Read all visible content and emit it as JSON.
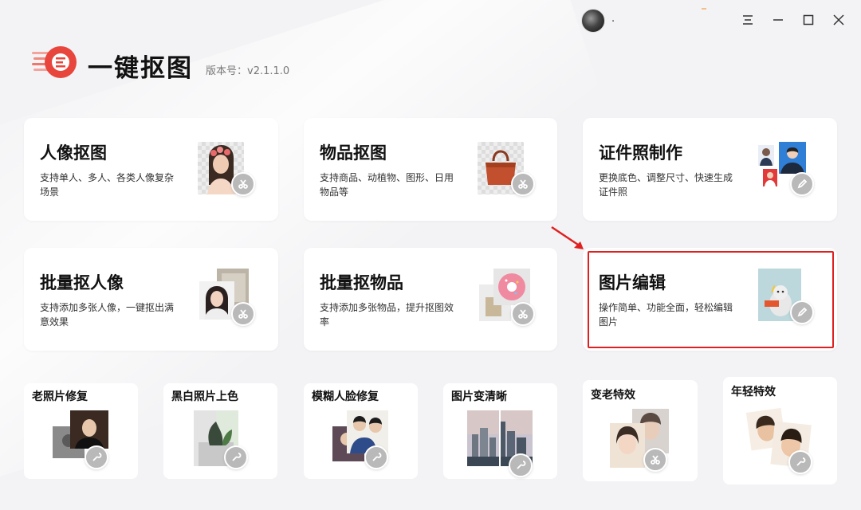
{
  "app": {
    "title": "一键抠图",
    "version": "版本号：v2.1.1.0"
  },
  "titlebar": {
    "user_name": ".",
    "icons": [
      "avatar",
      "menu-icon",
      "minimize-icon",
      "maximize-icon",
      "close-icon"
    ]
  },
  "cards": [
    {
      "title": "人像抠图",
      "desc": "支持单人、多人、各类人像复杂场景"
    },
    {
      "title": "物品抠图",
      "desc": "支持商品、动植物、图形、日用物品等"
    },
    {
      "title": "证件照制作",
      "desc": "更换底色、调整尺寸、快速生成证件照"
    },
    {
      "title": "批量抠人像",
      "desc": "支持添加多张人像，一键抠出满意效果"
    },
    {
      "title": "批量抠物品",
      "desc": "支持添加多张物品，提升抠图效率"
    },
    {
      "title": "图片编辑",
      "desc": "操作简单、功能全面，轻松编辑图片"
    }
  ],
  "small_cards": [
    {
      "title": "老照片修复"
    },
    {
      "title": "黑白照片上色"
    },
    {
      "title": "模糊人脸修复"
    },
    {
      "title": "图片变清晰"
    },
    {
      "title": "变老特效"
    },
    {
      "title": "年轻特效"
    }
  ],
  "colors": {
    "accent": "#e8453c",
    "highlight_border": "#e02020",
    "background": "#f3f3f5"
  }
}
